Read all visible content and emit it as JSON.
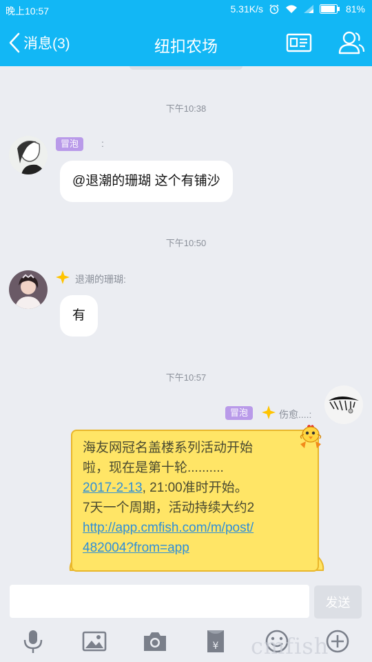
{
  "status_bar": {
    "time": "晚上10:57",
    "speed": "5.31K/s",
    "battery": "81%"
  },
  "header": {
    "back_label": "消息(3)",
    "title": "纽扣农场"
  },
  "chat": {
    "timestamps": [
      "下午10:38",
      "下午10:50",
      "下午10:57"
    ],
    "messages": [
      {
        "badge": "冒泡",
        "sender": ":",
        "text": "@退潮的珊瑚 这个有铺沙"
      },
      {
        "sender": "退潮的珊瑚:",
        "text": "有"
      },
      {
        "badge": "冒泡",
        "sender": "伤愈....:",
        "line1": "海友网冠名盖楼系列活动开始",
        "line2": "啦，现在是第十轮..........",
        "date_link": "2017-2-13",
        "line3_rest": ", 21:00准时开始。",
        "line4": "7天一个周期，活动持续大约2",
        "url_line1": "http://app.cmfish.com/m/post/",
        "url_line2": "482004?from=app"
      }
    ]
  },
  "input": {
    "value": "",
    "send_label": "发送"
  },
  "toolbar": {
    "icons": [
      "microphone-icon",
      "image-icon",
      "camera-icon",
      "red-packet-icon",
      "emoji-icon",
      "plus-icon"
    ]
  },
  "watermark": "cmfish",
  "colors": {
    "header_blue": "#12b7f5",
    "chat_bg": "#ebedf2",
    "badge_purple": "#b99ae9",
    "yellow_bubble": "#ffe566",
    "link_blue": "#2f8fd8"
  }
}
